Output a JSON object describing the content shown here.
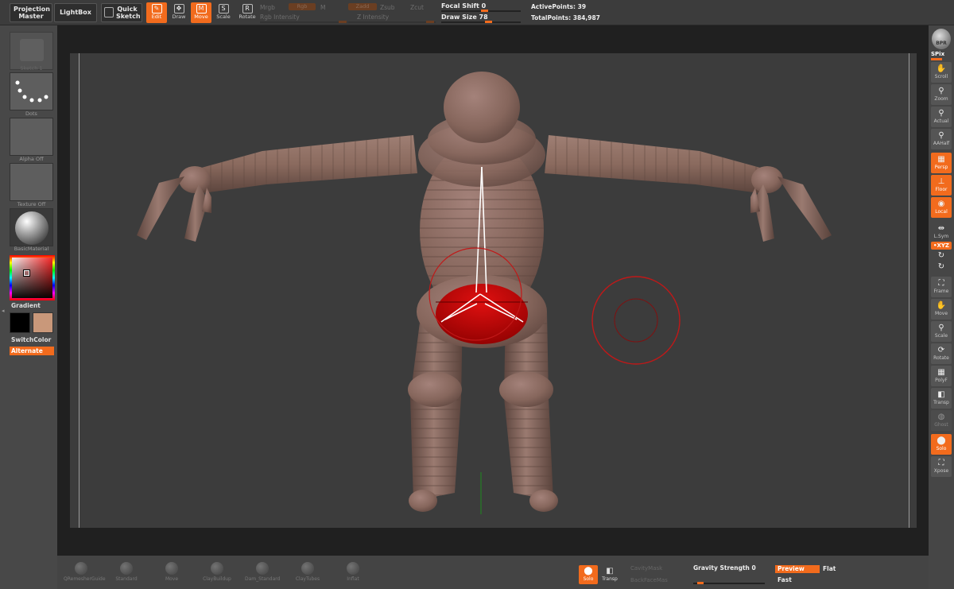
{
  "topbar": {
    "projection_master": "Projection Master",
    "lightbox": "LightBox",
    "quick_sketch": "Quick Sketch",
    "tools": [
      {
        "key": "edit",
        "label": "Edit",
        "glyph": "✎",
        "active": true
      },
      {
        "key": "draw",
        "label": "Draw",
        "glyph": "✥",
        "active": false
      },
      {
        "key": "move",
        "label": "Move",
        "glyph": "M",
        "active": true
      },
      {
        "key": "scale",
        "label": "Scale",
        "glyph": "S",
        "active": false
      },
      {
        "key": "rotate",
        "label": "Rotate",
        "glyph": "R",
        "active": false
      }
    ],
    "mrgb": "Mrgb",
    "rgb": "Rgb",
    "m": "M",
    "rgb_intensity": "Rgb Intensity",
    "zadd": "Zadd",
    "zsub": "Zsub",
    "zcut": "Zcut",
    "z_intensity": "Z Intensity",
    "focal_shift_label": "Focal Shift",
    "focal_shift_value": "0",
    "focal_shift_fraction": 0.5,
    "draw_size_label": "Draw Size",
    "draw_size_value": "78",
    "draw_size_fraction": 0.55,
    "active_points_label": "ActivePoints:",
    "active_points_value": "39",
    "total_points_label": "TotalPoints:",
    "total_points_value": "384,987"
  },
  "leftpanel": {
    "sketch_label": "Sketch 1",
    "stroke_label": "Dots",
    "alpha_label": "Alpha Off",
    "texture_label": "Texture Off",
    "material_label": "BasicMaterial",
    "gradient_label": "Gradient",
    "switchcolor_label": "SwitchColor",
    "alternate_label": "Alternate",
    "main_color": "#000000",
    "secondary_color": "#c9987a"
  },
  "rightpanel": {
    "bpr": "BPR",
    "spix": "SPix",
    "items": [
      {
        "key": "scroll",
        "label": "Scroll",
        "glyph": "✋",
        "state": "normal"
      },
      {
        "key": "zoom",
        "label": "Zoom",
        "glyph": "⚲",
        "state": "normal"
      },
      {
        "key": "actual",
        "label": "Actual",
        "glyph": "⚲",
        "state": "normal"
      },
      {
        "key": "aahalf",
        "label": "AAHalf",
        "glyph": "⚲",
        "state": "normal"
      },
      {
        "key": "persp",
        "label": "Persp",
        "glyph": "▦",
        "state": "on"
      },
      {
        "key": "floor",
        "label": "Floor",
        "glyph": "⊥",
        "state": "on"
      },
      {
        "key": "local",
        "label": "Local",
        "glyph": "◉",
        "state": "on"
      },
      {
        "key": "lsym",
        "label": "L.Sym",
        "glyph": "⇹",
        "state": "plain"
      },
      {
        "key": "xyz",
        "label": "•XYZ",
        "glyph": "",
        "state": "on"
      },
      {
        "key": "rot1",
        "label": "",
        "glyph": "↻",
        "state": "plain"
      },
      {
        "key": "rot2",
        "label": "",
        "glyph": "↻",
        "state": "plain"
      },
      {
        "key": "frame",
        "label": "Frame",
        "glyph": "⛶",
        "state": "normal"
      },
      {
        "key": "move",
        "label": "Move",
        "glyph": "✋",
        "state": "normal"
      },
      {
        "key": "scale",
        "label": "Scale",
        "glyph": "⚲",
        "state": "normal"
      },
      {
        "key": "rotate",
        "label": "Rotate",
        "glyph": "⟳",
        "state": "normal"
      },
      {
        "key": "polyf",
        "label": "PolyF",
        "glyph": "▦",
        "state": "normal"
      },
      {
        "key": "transp",
        "label": "Transp",
        "glyph": "◧",
        "state": "normal"
      },
      {
        "key": "ghost",
        "label": "Ghost",
        "glyph": "◍",
        "state": "dim"
      },
      {
        "key": "solo",
        "label": "Solo",
        "glyph": "⬤",
        "state": "on"
      },
      {
        "key": "xpose",
        "label": "Xpose",
        "glyph": "⛶",
        "state": "normal"
      }
    ]
  },
  "bottombar": {
    "brushes": [
      "QRemesherGuide",
      "Standard",
      "Move",
      "ClayBuildup",
      "Dam_Standard",
      "ClayTubes",
      "Inflat"
    ],
    "solo": "Solo",
    "transp": "Transp",
    "cavity_mask": "CavityMask",
    "backface_mask": "BackFaceMas",
    "gravity_label": "Gravity Strength",
    "gravity_value": "0",
    "gravity_fraction": 0.05,
    "preview": "Preview",
    "flat": "Flat",
    "fast": "Fast"
  },
  "colors": {
    "accent": "#f26b1d",
    "model": "#8a6a5e",
    "mask_red": "#c80000",
    "cursor_ring": "#c01818"
  }
}
